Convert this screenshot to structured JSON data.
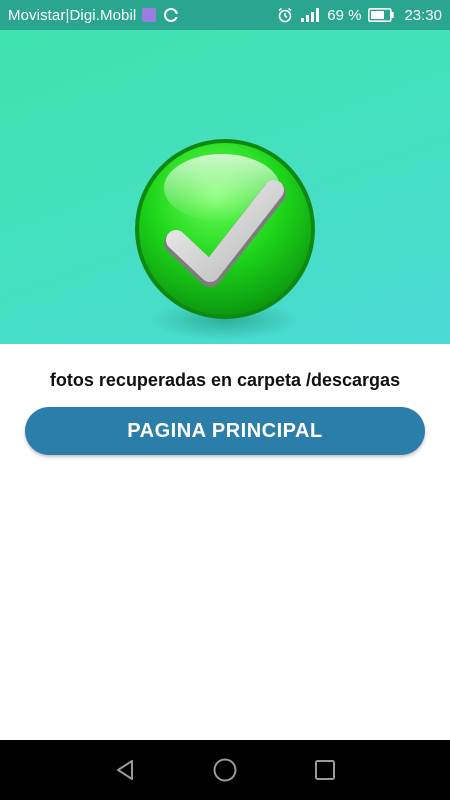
{
  "status_bar": {
    "carrier": "Movistar|Digi.Mobil",
    "battery_percent": "69 %",
    "time": "23:30",
    "icons": [
      "app-badge-icon",
      "google-icon",
      "alarm-icon",
      "signal-icon",
      "battery-icon"
    ]
  },
  "hero": {
    "icon": "check-icon",
    "colors": {
      "gradient_start": "#3ee3ad",
      "gradient_end": "#4ad9d6",
      "check_green": "#19d519"
    }
  },
  "message": "fotos recuperadas en carpeta /descargas",
  "primary_button": {
    "label": "PAGINA PRINCIPAL",
    "color": "#2b7eaa"
  },
  "nav_bar": {
    "icons": [
      "back-icon",
      "home-icon",
      "recents-icon"
    ]
  }
}
